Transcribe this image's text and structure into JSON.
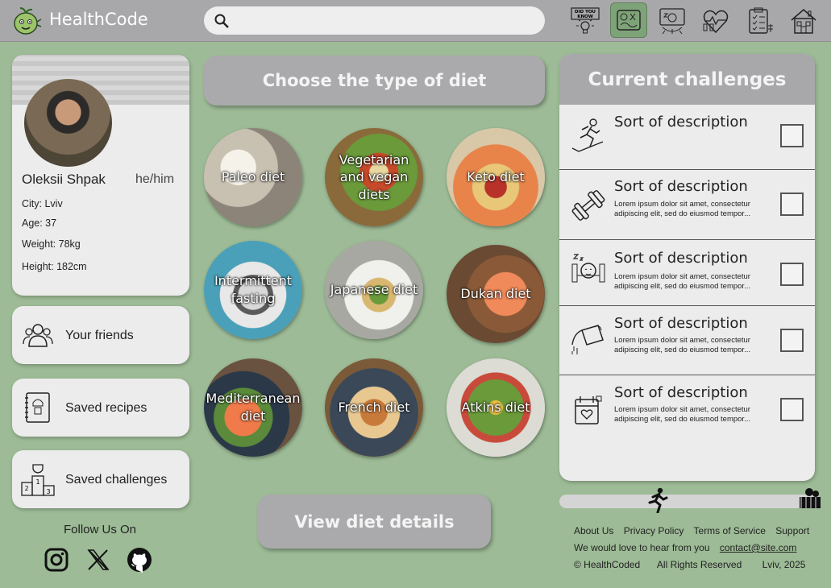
{
  "app": {
    "brand": "HealthCode"
  },
  "search": {
    "placeholder": ""
  },
  "nav": [
    {
      "icon": "did-you-know-icon",
      "label": "DID YOU KNOW"
    },
    {
      "icon": "diet-icon",
      "active": true
    },
    {
      "icon": "sleep-icon"
    },
    {
      "icon": "heart-fitness-icon"
    },
    {
      "icon": "checklist-icon"
    },
    {
      "icon": "home-icon"
    }
  ],
  "profile": {
    "name": "Oleksii Shpak",
    "pronouns": "he/him",
    "city": "City: Lviv",
    "age": "Age: 37",
    "weight": "Weight: 78kg",
    "height": "Height: 182cm"
  },
  "sidebar": {
    "friends": "Your friends",
    "recipes": "Saved recipes",
    "challenges": "Saved challenges"
  },
  "follow": {
    "label": "Follow Us On",
    "networks": [
      "instagram-icon",
      "x-icon",
      "github-icon"
    ]
  },
  "diet": {
    "heading": "Choose the type of diet",
    "view_button": "View diet details",
    "items": [
      {
        "label": "Paleo diet",
        "color": "#b8b4a8"
      },
      {
        "label": "Vegetarian and vegan diets",
        "color": "#8a9a4a"
      },
      {
        "label": "Keto diet",
        "color": "#c47a58"
      },
      {
        "label": "Intermittent fasting",
        "color": "#5a9aa8"
      },
      {
        "label": "Japanese diet",
        "color": "#a9a9a2"
      },
      {
        "label": "Dukan diet",
        "color": "#b06a48"
      },
      {
        "label": "Mediterranean diet",
        "color": "#6a5a48"
      },
      {
        "label": "French diet",
        "color": "#8a6a42"
      },
      {
        "label": "Atkins diet",
        "color": "#6a8a4a"
      }
    ]
  },
  "challenges": {
    "heading": "Current challenges",
    "items": [
      {
        "icon": "running-icon",
        "title": "Sort of description",
        "desc": ""
      },
      {
        "icon": "dumbbell-icon",
        "title": "Sort of description",
        "desc": "Lorem ipsum dolor sit amet, consectetur adipiscing elit, sed do eiusmod tempor..."
      },
      {
        "icon": "sleep-icon",
        "title": "Sort of description",
        "desc": "Lorem ipsum dolor sit amet, consectetur adipiscing elit, sed do eiusmod tempor..."
      },
      {
        "icon": "watering-can-icon",
        "title": "Sort of description",
        "desc": "Lorem ipsum dolor sit amet, consectetur adipiscing elit, sed do eiusmod tempor..."
      },
      {
        "icon": "calendar-heart-icon",
        "title": "Sort of description",
        "desc": "Lorem ipsum dolor sit amet, consectetur adipiscing elit, sed do eiusmod tempor..."
      }
    ]
  },
  "progress": {
    "value": 0.35
  },
  "footer": {
    "links": [
      "About Us",
      "Privacy Policy",
      "Terms of Service",
      "Support"
    ],
    "contact_text": "We would love to hear from you",
    "contact_email": "contact@site.com",
    "copyright": "© HealthCoded",
    "rights": "All Rights Reserved",
    "place": "Lviv, 2025"
  },
  "colors": {
    "background": "#9dbb96",
    "header": "#a8a8ab",
    "card": "#ececec",
    "active_nav": "#7fa378"
  }
}
